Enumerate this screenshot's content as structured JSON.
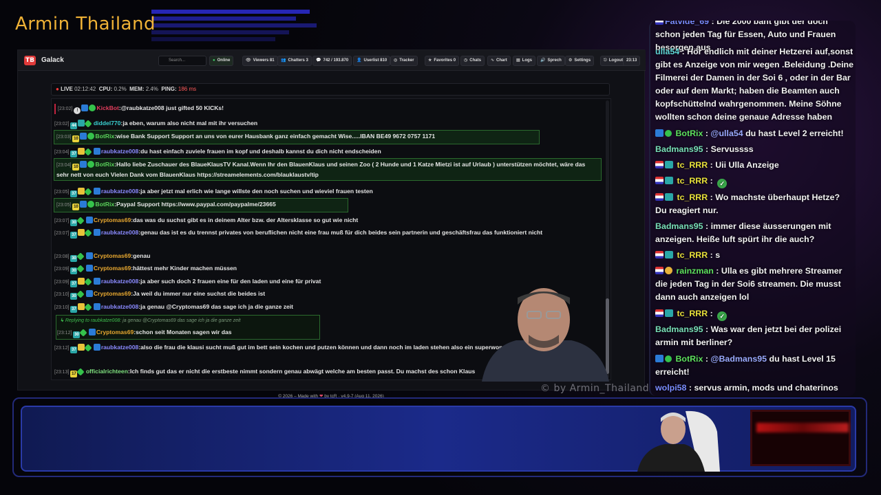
{
  "overlay": {
    "title": "Armin Thailand",
    "watermark": "© by Armin_Thailand"
  },
  "app": {
    "name": "Galack",
    "logo": "TB",
    "search_placeholder": "Search...",
    "nav": [
      {
        "icon": "●",
        "label": "Online"
      },
      {
        "icon": "👁",
        "label": "Viewers 81"
      },
      {
        "icon": "👥",
        "label": "Chatters 3"
      },
      {
        "icon": "💬",
        "label": "742 / 193.870"
      },
      {
        "icon": "👤",
        "label": "Userlist 810"
      },
      {
        "icon": "◎",
        "label": "Tracker"
      },
      {
        "icon": "★",
        "label": "Favorites 0"
      },
      {
        "icon": "◷",
        "label": "Chats"
      },
      {
        "icon": "∿",
        "label": "Chart"
      },
      {
        "icon": "▤",
        "label": "Logs"
      },
      {
        "icon": "🔊",
        "label": "Sprech"
      },
      {
        "icon": "⚙",
        "label": "Settings"
      },
      {
        "icon": "⎋",
        "label": "Logout"
      },
      {
        "icon": "",
        "label": "23:13"
      }
    ],
    "status": {
      "live_label": "LIVE",
      "live_time": "02:12:42",
      "cpu_label": "CPU:",
      "cpu": "0.2%",
      "mem_label": "MEM:",
      "mem": "2.4%",
      "ping_label": "PING:",
      "ping": "186 ms"
    },
    "footer": {
      "pre": "© 2026 – Made with",
      "heart": "❤",
      "post": "by tcR · v4.9-7 (Aug 11, 2026)"
    }
  },
  "chat": [
    {
      "time": "[23:02]",
      "user": "KickBot",
      "text": "@raubkatze008 just gifted 50 KICKs!"
    },
    {
      "time": "[23:02]",
      "user": "diddel770",
      "text": "ja eben, warum also nicht mal mit ihr versuchen"
    },
    {
      "time": "[23:03]",
      "user": "BotRix",
      "text": "wise Bank Support Support an uns von eurer Hausbank ganz einfach gemacht Wise.....IBAN BE49 9672 0757 1171"
    },
    {
      "time": "[23:04]",
      "user": "raubkatze008",
      "text": "du hast einfach zuviele frauen im kopf und deshalb kannst du dich nicht endscheiden"
    },
    {
      "time": "[23:04]",
      "user": "BotRix",
      "text": "Hallo liebe Zuschauer des BlaueKlausTV Kanal.Wenn Ihr den BlauenKlaus und seinen Zoo ( 2 Hunde und 1 Katze Mietzi ist auf Urlaub ) unterstützen möchtet, wäre das sehr nett von euch Vielen Dank vom BlauenKlaus https://streamelements.com/blauklaustv/tip"
    },
    {
      "time": "[23:05]",
      "user": "raubkatze008",
      "text": "ja aber jetzt mal erlich wie lange willste den noch suchen und wieviel frauen testen"
    },
    {
      "time": "[23:05]",
      "user": "BotRix",
      "text": "Paypal Support https://www.paypal.com/paypalme/23665"
    },
    {
      "time": "[23:07]",
      "user": "Cryptomas69",
      "text": "das was du suchst gibt es in deinem Alter bzw. der Altersklasse so gut wie nicht"
    },
    {
      "time": "[23:07]",
      "user": "raubkatze008",
      "text": "genau das ist es du trennst privates von beruflichen nicht eine frau muß für dich beides sein partnerin und geschäftsfrau das funktioniert nicht"
    },
    {
      "time": "[23:08]",
      "user": "Cryptomas69",
      "text": "genau"
    },
    {
      "time": "[23:09]",
      "user": "Cryptomas69",
      "text": "hättest mehr Kinder machen müssen"
    },
    {
      "time": "[23:09]",
      "user": "raubkatze008",
      "text": "ja aber such doch 2 frauen eine für den laden und eine für privat"
    },
    {
      "time": "[23:10]",
      "user": "Cryptomas69",
      "text": "Ja weil du immer nur eine suchst die beides ist"
    },
    {
      "time": "[23:10]",
      "user": "raubkatze008",
      "text": "ja genau @Cryptomas69 das sage ich ja die ganze zeit"
    },
    {
      "time": "[23:12]",
      "user": "Cryptomas69",
      "text": "schon seit Monaten sagen wir das"
    },
    {
      "time": "[23:12]",
      "user": "raubkatze008",
      "text": "also die frau die klausi sucht muß gut im bett sein kochen und putzen können und dann noch im laden stehen also ein superwoman 555"
    },
    {
      "time": "[23:13]",
      "user": "officialrichteen",
      "text": "Ich finds gut das er nicht die erstbeste nimmt sondern genau abwägt welche am besten passt. Du machst des schon Klaus"
    }
  ],
  "reply": {
    "prefix": "Replying to",
    "target": "raubkatze008:",
    "quote": "ja genau @Cryptomas69 das sage ich ja die ganze zeit"
  },
  "rchat": [
    {
      "user": "Fatvide_69",
      "text": "Die 2000 baht gibt der doch schon jeden Tag für Essen, Auto und Frauen besorgen aus"
    },
    {
      "user": "ulla54",
      "text": "Hör endlich mit deiner Hetzerei auf,sonst gibt es Anzeige von mir wegen .Beleidung .Deine Filmerei der Damen in der Soi 6 , oder in der Bar oder auf dem Markt; haben die Beamten auch kopfschüttelnd wahrgenommen. Meine Söhne wollten schon deine genaue Adresse haben"
    },
    {
      "user": "BotRix",
      "mention": "@ulla54",
      "text": "du hast Level 2 erreicht!"
    },
    {
      "user": "Badmans95",
      "text": "Servussss"
    },
    {
      "user": "tc_RRR",
      "text": "Uii Ulla Anzeige"
    },
    {
      "user": "tc_RRR",
      "text": ""
    },
    {
      "user": "tc_RRR",
      "text": "Wo machste überhaupt Hetze? Du reagiert nur."
    },
    {
      "user": "Badmans95",
      "text": "immer diese äusserungen mit anzeigen. Heiße luft spürt ihr die auch?"
    },
    {
      "user": "tc_RRR",
      "text": "s"
    },
    {
      "user": "rainzman",
      "text": "Ulla es gibt mehrere Streamer die jeden Tag in der Soi6 streamen. Die musst dann auch anzeigen lol"
    },
    {
      "user": "tc_RRR",
      "text": ""
    },
    {
      "user": "Badmans95",
      "text": "Was war den jetzt bei der polizei armin mit berliner?"
    },
    {
      "user": "BotRix",
      "mention": "@Badmans95",
      "text": "du hast Level 15 erreicht!"
    },
    {
      "user": "wolpi58",
      "text": "servus armin, mods und chaterinos"
    }
  ],
  "colors": {
    "accent": "#f0b236",
    "live": "#ff3b3b",
    "highlight_border": "#2b6b2e",
    "panel_blue": "#1b2a8a"
  }
}
